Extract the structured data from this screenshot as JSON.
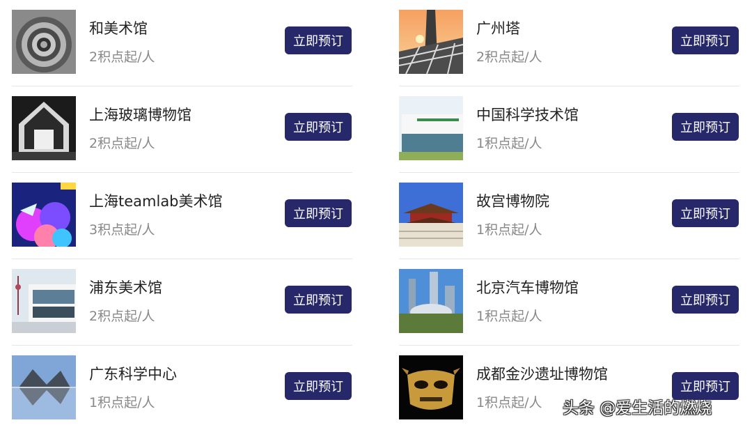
{
  "venues_left": [
    {
      "name": "和美术馆",
      "price": "2积点起/人",
      "button": "立即预订",
      "image": "spiral-staircase-photo"
    },
    {
      "name": "上海玻璃博物馆",
      "price": "2积点起/人",
      "button": "立即预订",
      "image": "glass-house-photo"
    },
    {
      "name": "上海teamlab美术馆",
      "price": "3积点起/人",
      "button": "立即预订",
      "image": "teamlab-digital-art-photo"
    },
    {
      "name": "浦东美术馆",
      "price": "2积点起/人",
      "button": "立即预订",
      "image": "pudong-museum-building-photo"
    },
    {
      "name": "广东科学中心",
      "price": "1积点起/人",
      "button": "立即预订",
      "image": "science-center-reflection-photo"
    }
  ],
  "venues_right": [
    {
      "name": "广州塔",
      "price": "2积点起/人",
      "button": "立即预订",
      "image": "canton-tower-photo"
    },
    {
      "name": "中国科学技术馆",
      "price": "1积点起/人",
      "button": "立即预订",
      "image": "science-museum-building-photo"
    },
    {
      "name": "故宫博物院",
      "price": "1积点起/人",
      "button": "立即预订",
      "image": "forbidden-city-photo"
    },
    {
      "name": "北京汽车博物馆",
      "price": "1积点起/人",
      "button": "立即预订",
      "image": "city-skyline-photo"
    },
    {
      "name": "成都金沙遗址博物馆",
      "price": "1积点起/人",
      "button": "立即预订",
      "image": "golden-mask-photo"
    }
  ],
  "watermark": "头条 @爱生活的燃烧",
  "colors": {
    "button_bg": "#27286a",
    "title": "#222222",
    "subtitle": "#888888",
    "divider": "#e6e6e6"
  }
}
